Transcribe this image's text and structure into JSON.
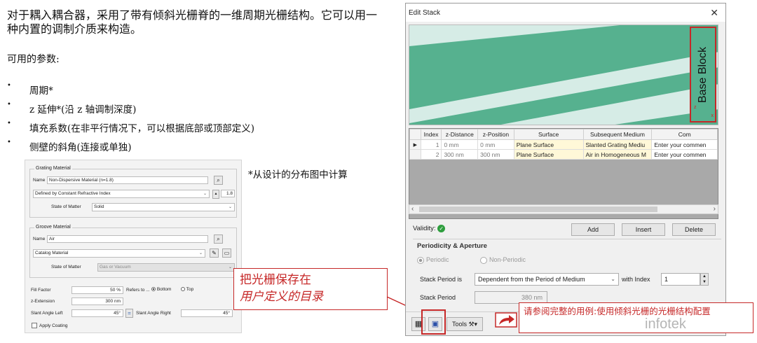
{
  "slide": {
    "intro": "对于耦入耦合器，采用了带有倾斜光栅脊的一维周期光栅结构。它可以用一种内置的调制介质来构造。",
    "params_title": "可用的参数:",
    "bullets": [
      "周期*",
      "z 延伸*(沿 z 轴调制深度)",
      "填充系数(在非平行情况下，可以根据底部或顶部定义)",
      "侧壁的斜角(连接或单独)"
    ],
    "calc_note": "*从设计的分布图中计算",
    "annotation_line1": "把光栅保存在",
    "annotation_line2": "用户定义的目录",
    "bottom_note": "请参阅完整的用例:使用倾斜光栅的光栅结构配置",
    "watermark": "infotek"
  },
  "grating_panel": {
    "grating_material_title": "Grating Material",
    "name_label": "Name",
    "name_value": "Non-Dispersive Material (n=1.8)",
    "def_select": "Defined by Constant Refractive Index",
    "index_value": "1.8",
    "state_label": "State of Matter",
    "state_value": "Solid",
    "groove_material_title": "Groove Material",
    "groove_name_label": "Name",
    "groove_name_value": "Air",
    "catalog_select": "Catalog Material",
    "groove_state_label": "State of Matter",
    "groove_state_value": "Gas or Vacuum",
    "fill_factor_label": "Fill Factor",
    "fill_factor_value": "50 %",
    "refers_to_label": "Refers to ...",
    "bottom_label": "Bottom",
    "top_label": "Top",
    "z_extension_label": "z-Extension",
    "z_extension_value": "300 nm",
    "slant_left_label": "Slant Angle Left",
    "slant_left_value": "45°",
    "link_symbol": "=",
    "slant_right_label": "Slant Angle Right",
    "slant_right_value": "45°",
    "apply_coating_label": "Apply Coating"
  },
  "dialog": {
    "title": "Edit Stack",
    "close_symbol": "✕",
    "base_block_label": "Base Block",
    "axis_z": "z",
    "axis_x": "x",
    "table": {
      "headers": [
        "Index",
        "z-Distance",
        "z-Position",
        "Surface",
        "Subsequent Medium",
        "Com"
      ],
      "rows": [
        [
          "1",
          "0 mm",
          "0 mm",
          "Plane Surface",
          "Slanted Grating Mediu",
          "Enter your commen"
        ],
        [
          "2",
          "300 nm",
          "300 nm",
          "Plane Surface",
          "Air in Homogeneous M",
          "Enter your commen"
        ]
      ]
    },
    "validity_label": "Validity:",
    "add_label": "Add",
    "insert_label": "Insert",
    "delete_label": "Delete",
    "periodicity_title": "Periodicity & Aperture",
    "periodic_label": "Periodic",
    "non_periodic_label": "Non-Periodic",
    "stack_period_is_label": "Stack Period is",
    "stack_period_is_value": "Dependent from the Period of Medium",
    "with_index_label": "with Index",
    "with_index_value": "1",
    "stack_period_label": "Stack Period",
    "stack_period_value": "380 nm",
    "tools_label": "Tools"
  },
  "colors": {
    "grating_dark": "#56b18f",
    "grating_light": "#d6ece6",
    "annotation_red": "#c62828"
  }
}
